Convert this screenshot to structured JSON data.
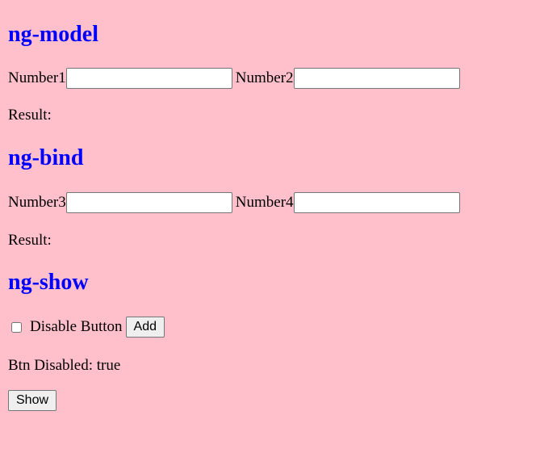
{
  "sections": {
    "model": {
      "title": "ng-model",
      "label1": "Number1",
      "value1": "",
      "label2": "Number2",
      "value2": "",
      "result_label": "Result:"
    },
    "bind": {
      "title": "ng-bind",
      "label1": "Number3",
      "value1": "",
      "label2": "Number4",
      "value2": "",
      "result_label": "Result:"
    },
    "show": {
      "title": "ng-show",
      "checkbox_label": "Disable Button",
      "checkbox_checked": false,
      "add_button": "Add",
      "status_text": "Btn Disabled: true",
      "show_button": "Show"
    }
  },
  "colors": {
    "background": "#ffc0cb",
    "heading": "#0000ff"
  }
}
